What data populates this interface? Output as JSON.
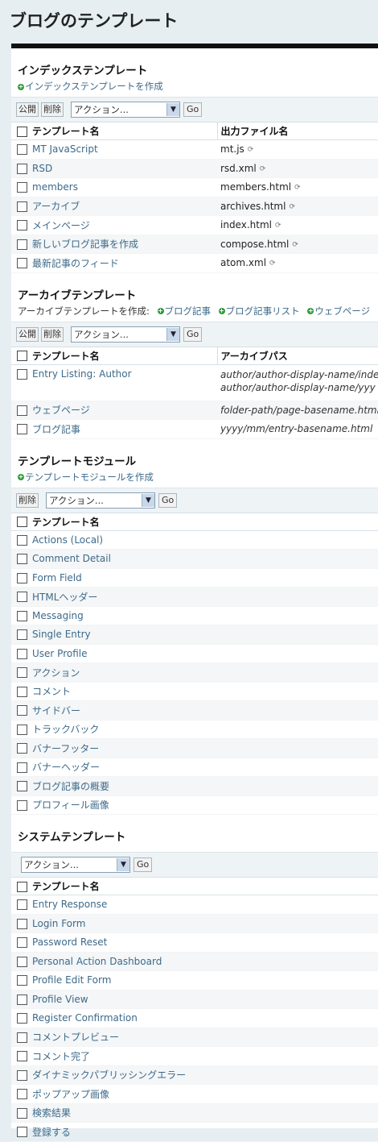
{
  "page_title": "ブログのテンプレート",
  "index": {
    "title": "インデックステンプレート",
    "create_link": "インデックステンプレートを作成",
    "publish_button": "公開",
    "delete_button": "削除",
    "action_select": "アクション...",
    "go_button": "Go",
    "columns": [
      "テンプレート名",
      "出力ファイル名"
    ],
    "rows": [
      {
        "name": "MT JavaScript",
        "file": "mt.js"
      },
      {
        "name": "RSD",
        "file": "rsd.xml"
      },
      {
        "name": "members",
        "file": "members.html"
      },
      {
        "name": "アーカイブ",
        "file": "archives.html"
      },
      {
        "name": "メインページ",
        "file": "index.html"
      },
      {
        "name": "新しいブログ記事を作成",
        "file": "compose.html"
      },
      {
        "name": "最新記事のフィード",
        "file": "atom.xml"
      }
    ]
  },
  "archive": {
    "title": "アーカイブテンプレート",
    "create_label": "アーカイブテンプレートを作成:",
    "create_links": [
      "ブログ記事",
      "ブログ記事リスト",
      "ウェブページ"
    ],
    "publish_button": "公開",
    "delete_button": "削除",
    "action_select": "アクション...",
    "go_button": "Go",
    "columns": [
      "テンプレート名",
      "アーカイブパス"
    ],
    "rows": [
      {
        "name": "Entry Listing: Author",
        "path1": "author/author-display-name/inde",
        "path2": "author/author-display-name/yyy"
      },
      {
        "name": "ウェブページ",
        "path1": "folder-path/page-basename.html"
      },
      {
        "name": "ブログ記事",
        "path1": "yyyy/mm/entry-basename.html"
      }
    ]
  },
  "modules": {
    "title": "テンプレートモジュール",
    "create_link": "テンプレートモジュールを作成",
    "delete_button": "削除",
    "action_select": "アクション...",
    "go_button": "Go",
    "columns": [
      "テンプレート名"
    ],
    "rows": [
      "Actions (Local)",
      "Comment Detail",
      "Form Field",
      "HTMLヘッダー",
      "Messaging",
      "Single Entry",
      "User Profile",
      "アクション",
      "コメント",
      "サイドバー",
      "トラックバック",
      "バナーフッター",
      "バナーヘッダー",
      "ブログ記事の概要",
      "プロフィール画像"
    ]
  },
  "system": {
    "title": "システムテンプレート",
    "action_select": "アクション...",
    "go_button": "Go",
    "columns": [
      "テンプレート名"
    ],
    "rows": [
      "Entry Response",
      "Login Form",
      "Password Reset",
      "Personal Action Dashboard",
      "Profile Edit Form",
      "Profile View",
      "Register Confirmation",
      "コメントプレビュー",
      "コメント完了",
      "ダイナミックパブリッシングエラー",
      "ポップアップ画像",
      "検索結果",
      "登録する"
    ]
  }
}
